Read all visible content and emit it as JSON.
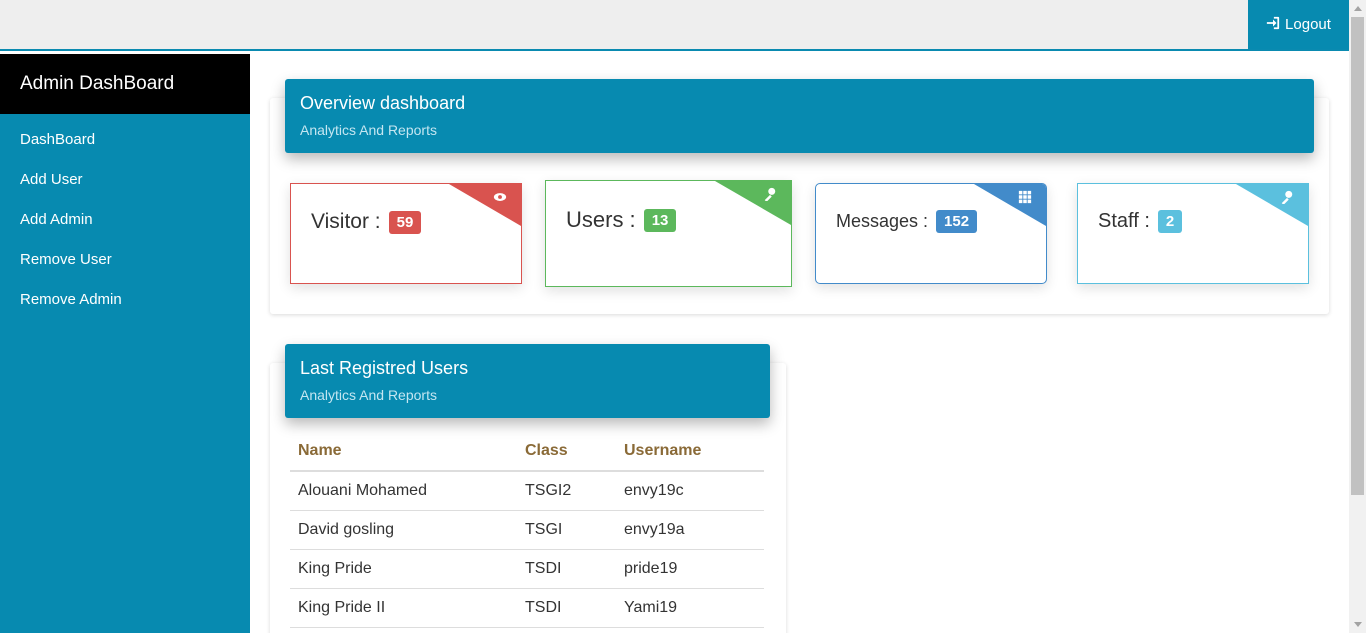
{
  "header": {
    "logout_label": "Logout"
  },
  "sidebar": {
    "title": "Admin DashBoard",
    "items": [
      {
        "label": "DashBoard"
      },
      {
        "label": "Add User"
      },
      {
        "label": "Add Admin"
      },
      {
        "label": "Remove User"
      },
      {
        "label": "Remove Admin"
      }
    ]
  },
  "overview": {
    "title": "Overview dashboard",
    "subtitle": "Analytics And Reports",
    "cards": [
      {
        "label": "Visitor :",
        "count": "59",
        "color": "#d9534f",
        "icon": "eye-icon"
      },
      {
        "label": "Users :",
        "count": "13",
        "color": "#5cb85c",
        "icon": "user-icon"
      },
      {
        "label": "Messages :",
        "count": "152",
        "color": "#428bca",
        "icon": "grid-icon"
      },
      {
        "label": "Staff :",
        "count": "2",
        "color": "#5bc0de",
        "icon": "user-icon"
      }
    ]
  },
  "users_panel": {
    "title": "Last Registred Users",
    "subtitle": "Analytics And Reports",
    "columns": [
      "Name",
      "Class",
      "Username"
    ],
    "rows": [
      [
        "Alouani Mohamed",
        "TSGI2",
        "envy19c"
      ],
      [
        "David gosling",
        "TSGI",
        "envy19a"
      ],
      [
        "King Pride",
        "TSDI",
        "pride19"
      ],
      [
        "King Pride II",
        "TSDI",
        "Yami19"
      ]
    ]
  },
  "colors": {
    "primary": "#078ab0",
    "sidebar_head": "#000000",
    "table_header": "#8a6a37"
  }
}
